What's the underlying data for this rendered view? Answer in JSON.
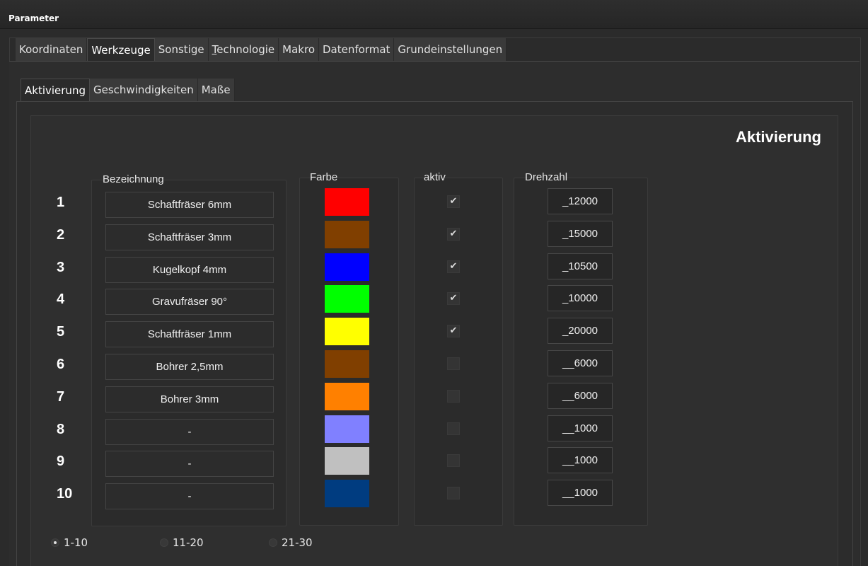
{
  "window": {
    "title": "Parameter"
  },
  "main_tabs": [
    {
      "label": "Koordinaten",
      "active": false
    },
    {
      "label": "Werkzeuge",
      "active": true
    },
    {
      "label": "Sonstige",
      "active": false
    },
    {
      "label": "Technologie",
      "active": false
    },
    {
      "label": "Makro",
      "active": false
    },
    {
      "label": "Datenformat",
      "active": false
    },
    {
      "label": "Grundeinstellungen",
      "active": false
    }
  ],
  "sub_tabs": [
    {
      "label": "Aktivierung",
      "active": true
    },
    {
      "label": "Geschwindigkeiten",
      "active": false
    },
    {
      "label": "Maße",
      "active": false
    }
  ],
  "panel": {
    "heading": "Aktivierung",
    "columns": {
      "name": "Bezeichnung",
      "color": "Farbe",
      "active": "aktiv",
      "rpm": "Drehzahl"
    },
    "tools": [
      {
        "num": "1",
        "name": "Schaftfräser 6mm",
        "color": "#ff0000",
        "active": true,
        "rpm": "_12000"
      },
      {
        "num": "2",
        "name": "Schaftfräser 3mm",
        "color": "#803f00",
        "active": true,
        "rpm": "_15000"
      },
      {
        "num": "3",
        "name": "Kugelkopf 4mm",
        "color": "#0000ff",
        "active": true,
        "rpm": "_10500"
      },
      {
        "num": "4",
        "name": "Gravufräser 90°",
        "color": "#00ff00",
        "active": true,
        "rpm": "_10000"
      },
      {
        "num": "5",
        "name": "Schaftfräser 1mm",
        "color": "#ffff00",
        "active": true,
        "rpm": "_20000"
      },
      {
        "num": "6",
        "name": "Bohrer 2,5mm",
        "color": "#803f00",
        "active": false,
        "rpm": "__6000"
      },
      {
        "num": "7",
        "name": "Bohrer 3mm",
        "color": "#ff8000",
        "active": false,
        "rpm": "__6000"
      },
      {
        "num": "8",
        "name": "-",
        "color": "#8080ff",
        "active": false,
        "rpm": "__1000"
      },
      {
        "num": "9",
        "name": "-",
        "color": "#c0c0c0",
        "active": false,
        "rpm": "__1000"
      },
      {
        "num": "10",
        "name": "-",
        "color": "#003c80",
        "active": false,
        "rpm": "__1000"
      }
    ]
  },
  "range_options": [
    {
      "label": "1-10",
      "selected": true
    },
    {
      "label": "11-20",
      "selected": false
    },
    {
      "label": "21-30",
      "selected": false
    }
  ],
  "icons": {
    "check": "checkmark-icon"
  }
}
